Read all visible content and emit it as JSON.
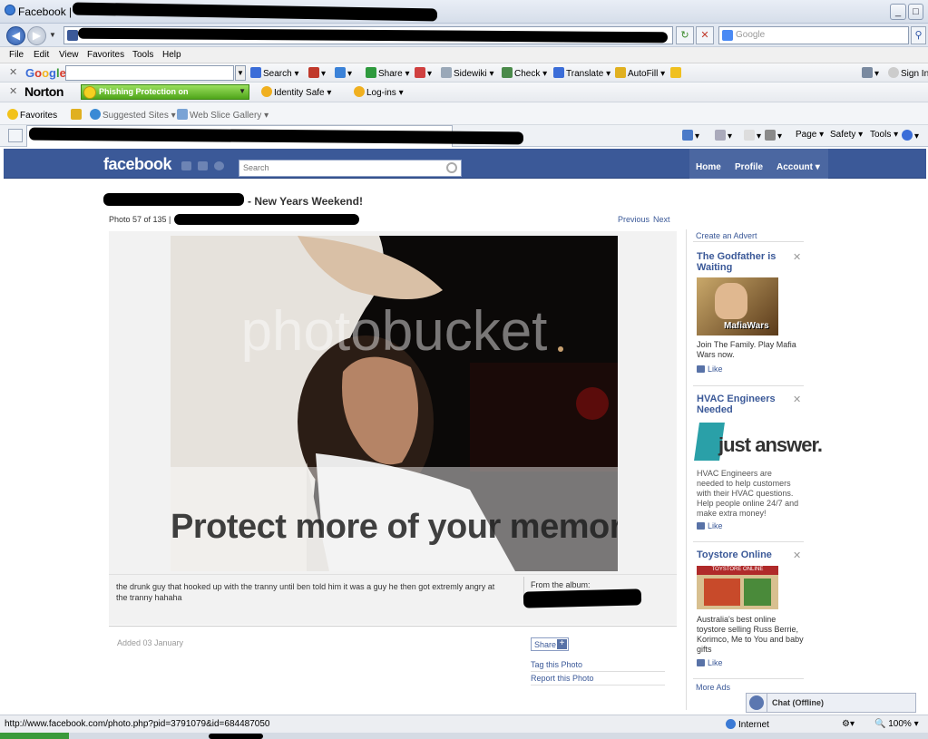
{
  "window": {
    "title": "Facebook |"
  },
  "ie": {
    "search_placeholder": "Google",
    "menu": [
      "File",
      "Edit",
      "View",
      "Favorites",
      "Tools",
      "Help"
    ],
    "google_toolbar": {
      "brand": "Google",
      "items": [
        "Search ▾",
        "Share ▾",
        "Sidewiki ▾",
        "Check ▾",
        "Translate ▾",
        "AutoFill ▾"
      ],
      "sign_in": "Sign In"
    },
    "norton_toolbar": {
      "brand": "Norton",
      "phishing": "Phishing Protection on",
      "identity_safe": "Identity Safe ▾",
      "logins": "Log-ins ▾"
    },
    "favorites_bar": {
      "favorites": "Favorites",
      "suggested": "Suggested Sites ▾",
      "web_slice": "Web Slice Gallery ▾"
    },
    "command_bar": [
      "Page ▾",
      "Safety ▾",
      "Tools ▾"
    ]
  },
  "facebook": {
    "logo": "facebook",
    "search_placeholder": "Search",
    "nav": {
      "home": "Home",
      "profile": "Profile",
      "account": "Account ▾"
    },
    "album_title_suffix": "- New Years Weekend!",
    "photo_count": "Photo 57 of 135 |",
    "previous": "Previous",
    "next": "Next",
    "watermark_top": "photobucket",
    "watermark_bottom": "Protect more of your memories",
    "caption": "the drunk guy that hooked up with the tranny until ben told him it was a guy he then got extremly angry at the tranny hahaha",
    "from_album": "From the album:",
    "added": "Added 03 January",
    "share": "Share",
    "tag_photo": "Tag this Photo",
    "report_photo": "Report this Photo",
    "create_advert": "Create an Advert",
    "ads": [
      {
        "title": "The Godfather is Waiting",
        "image_label": "MafiaWars",
        "text": "Join The Family. Play Mafia Wars now.",
        "like": "Like"
      },
      {
        "title": "HVAC Engineers Needed",
        "image_label": "just answer.",
        "text": "HVAC Engineers are needed to help customers with their HVAC questions. Help people online 24/7 and make extra money!",
        "like": "Like"
      },
      {
        "title": "Toystore Online",
        "image_label": "TOYSTORE ONLINE",
        "text": "Australia's best online toystore selling Russ Berrie, Korimco, Me to You and baby gifts",
        "like": "Like"
      }
    ],
    "more_ads": "More Ads",
    "chat": "Chat (Offline)"
  },
  "status": {
    "url": "http://www.facebook.com/photo.php?pid=3791079&id=684487050",
    "zone": "Internet",
    "zoom": "100%"
  }
}
